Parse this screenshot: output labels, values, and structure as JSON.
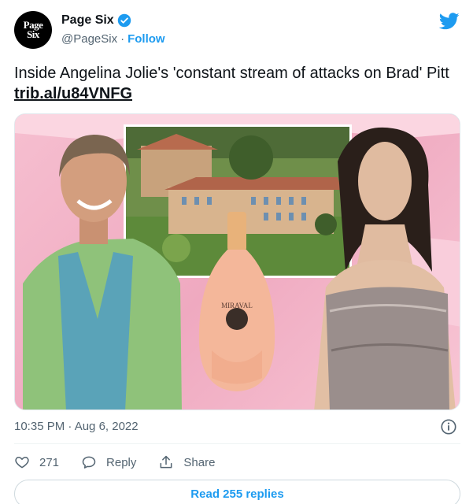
{
  "account": {
    "avatar_text_line1": "Page",
    "avatar_text_line2": "Six",
    "display_name": "Page Six",
    "handle": "@PageSix",
    "separator": "·",
    "follow_label": "Follow"
  },
  "tweet": {
    "text": "Inside Angelina Jolie's 'constant stream of attacks on Brad' Pitt ",
    "link": "trib.al/u84VNFG",
    "media_label": "MIRAVAL"
  },
  "meta": {
    "timestamp": "10:35 PM · Aug 6, 2022"
  },
  "actions": {
    "likes_count": "271",
    "reply_label": "Reply",
    "share_label": "Share"
  },
  "read_replies_label": "Read 255 replies",
  "colors": {
    "accent": "#1d9bf0",
    "text": "#0f1419",
    "muted": "#536471",
    "media_pink": "#f2b3c7"
  }
}
